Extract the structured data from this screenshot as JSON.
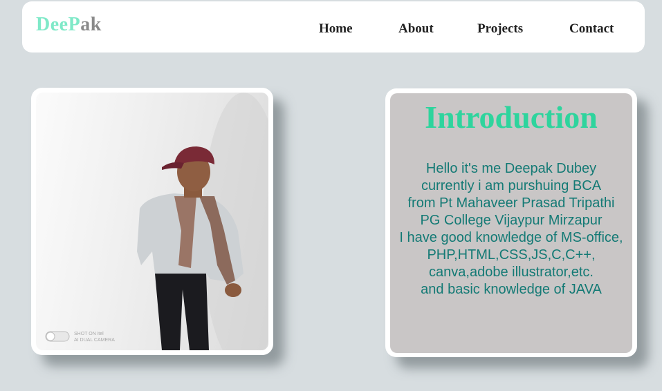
{
  "header": {
    "logo": {
      "part1": "Dee",
      "part2": "P",
      "part3": "ak"
    },
    "nav": [
      {
        "label": "Home"
      },
      {
        "label": "About"
      },
      {
        "label": "Projects"
      },
      {
        "label": "Contact"
      }
    ]
  },
  "photo": {
    "watermark_line1": "SHOT ON itel",
    "watermark_line2": "AI DUAL CAMERA"
  },
  "intro": {
    "title": "Introduction",
    "lines": [
      "Hello it's me Deepak Dubey",
      "currently i am purshuing BCA",
      "from Pt Mahaveer Prasad Tripathi",
      "PG College Vijaypur Mirzapur",
      "I have good knowledge of MS-office,",
      "PHP,HTML,CSS,JS,C,C++,",
      "canva,adobe illustrator,etc.",
      "and basic knowledge of JAVA"
    ]
  },
  "colors": {
    "page_bg": "#d7dde0",
    "logo_accent": "#7fe9c8",
    "logo_gray": "#8a8a8a",
    "intro_title": "#2ed49d",
    "intro_text": "#147a75",
    "intro_bg": "#c9c6c6"
  }
}
